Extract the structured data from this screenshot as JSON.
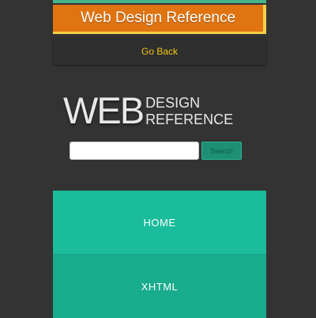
{
  "header": {
    "title": "Web Design Reference",
    "go_back": "Go Back"
  },
  "logo": {
    "big": "WEB",
    "line1": "DESIGN",
    "line2": "REFERENCE"
  },
  "search": {
    "value": "",
    "placeholder": "",
    "button_label": "Search"
  },
  "nav": {
    "items": [
      {
        "label": "HOME"
      },
      {
        "label": "XHTML"
      }
    ]
  },
  "colors": {
    "background": "#333333",
    "header_orange": "#e07410",
    "header_border": "#f3d04a",
    "go_back_text": "#f0c419",
    "nav_teal": "#1abc9c",
    "nav_teal_dark": "#18ab8c",
    "search_button": "#1d8f74"
  }
}
